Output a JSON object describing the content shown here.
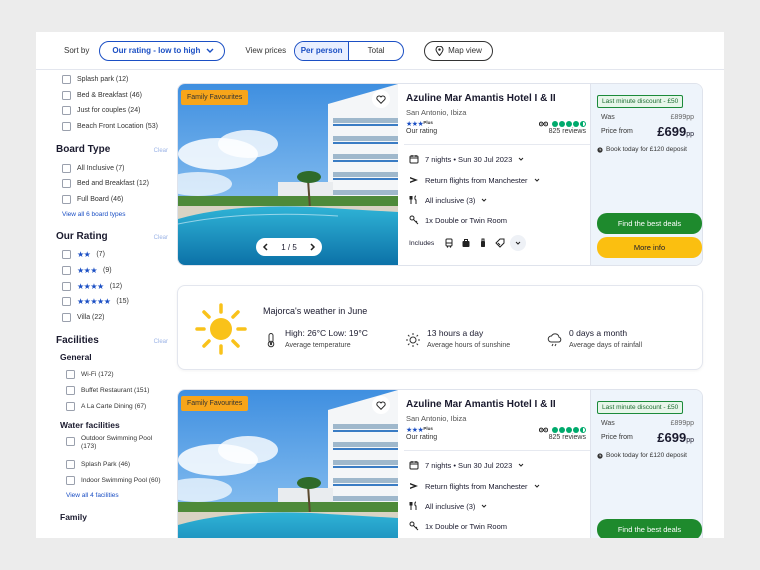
{
  "toolbar": {
    "sort_label": "Sort by",
    "sort_value": "Our rating - low to high",
    "view_prices_label": "View prices",
    "per_person": "Per person",
    "total": "Total",
    "map_view": "Map view"
  },
  "sidebar": {
    "top_options": [
      {
        "label": "Splash park (12)"
      },
      {
        "label": "Bed & Breakfast (46)"
      },
      {
        "label": "Just for couples (24)"
      },
      {
        "label": "Beach Front Location (53)"
      }
    ],
    "board": {
      "title": "Board Type",
      "clear": "Clear",
      "options": [
        {
          "label": "All Inclusive (7)"
        },
        {
          "label": "Bed and Breakfast (12)"
        },
        {
          "label": "Full Board (46)"
        }
      ],
      "view_all": "View all 6 board types"
    },
    "rating": {
      "title": "Our Rating",
      "clear": "Clear",
      "options": [
        {
          "stars": "★★",
          "count": "(7)"
        },
        {
          "stars": "★★★",
          "count": "(9)"
        },
        {
          "stars": "★★★★",
          "count": "(12)"
        },
        {
          "stars": "★★★★★",
          "count": "(15)"
        }
      ],
      "villa": "Villa (22)"
    },
    "facilities": {
      "title": "Facilities",
      "clear": "Clear",
      "general_title": "General",
      "general": [
        {
          "label": "Wi-Fi (172)"
        },
        {
          "label": "Buffet Restaurant (151)"
        },
        {
          "label": "A La Carte Dining (67)"
        }
      ],
      "water_title": "Water facilities",
      "water": [
        {
          "label": "Outdoor Swimming Pool (173)"
        },
        {
          "label": "Splash Park (46)"
        },
        {
          "label": "Indoor Swimming Pool (60)"
        }
      ],
      "view_all": "View all 4 facilities",
      "family_title": "Family"
    }
  },
  "cards": [
    {
      "badge": "Family Favourites",
      "pager": "1 / 5",
      "name": "Azuline Mar Amantis Hotel I & II",
      "location": "San Antonio, Ibiza",
      "stars": "★★★",
      "plus": "Plus",
      "our_rating": "Our rating",
      "reviews": "825 reviews",
      "nights": "7 nights • Sun 30 Jul 2023",
      "flights": "Return flights from Manchester",
      "board": "All inclusive (3)",
      "room": "1x Double or Twin Room",
      "includes": "Includes",
      "discount": "Last minute discount  - £50",
      "was_label": "Was",
      "was_value": "£899pp",
      "price_from": "Price from",
      "price": "£699",
      "pp": "pp",
      "deposit": "Book today for £120 deposit",
      "cta": "Find the best deals",
      "more": "More info"
    },
    {
      "badge": "Family Favourites",
      "name": "Azuline Mar Amantis Hotel I & II",
      "location": "San Antonio, Ibiza",
      "stars": "★★★",
      "plus": "Plus",
      "our_rating": "Our rating",
      "reviews": "825 reviews",
      "nights": "7 nights • Sun 30 Jul 2023",
      "flights": "Return flights from Manchester",
      "board": "All inclusive (3)",
      "room": "1x Double or Twin Room",
      "discount": "Last minute discount  - £50",
      "was_label": "Was",
      "was_value": "£899pp",
      "price_from": "Price from",
      "price": "£699",
      "pp": "pp",
      "deposit": "Book today for £120 deposit",
      "cta": "Find the best deals"
    }
  ],
  "weather": {
    "title": "Majorca's weather in June",
    "temp": "High: 26°C Low: 19°C",
    "temp_label": "Average temperature",
    "sun": "13 hours a day",
    "sun_label": "Average hours of sunshine",
    "rain": "0 days a month",
    "rain_label": "Average days of rainfall"
  },
  "colors": {
    "accent": "#1b4fc4",
    "cta_green": "#1e8a2d",
    "cta_yellow": "#fbbf10",
    "badge_orange": "#f7a51a",
    "sun_yellow": "#f9c21a"
  }
}
